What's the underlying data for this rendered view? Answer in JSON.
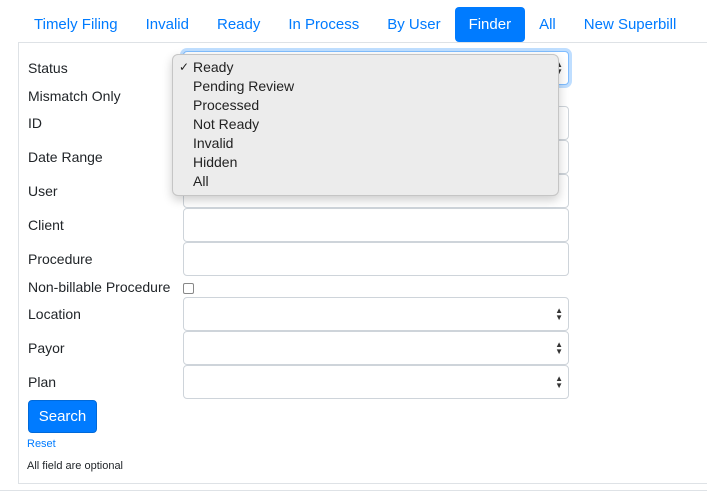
{
  "tabs": [
    {
      "label": "Timely Filing"
    },
    {
      "label": "Invalid"
    },
    {
      "label": "Ready"
    },
    {
      "label": "In Process"
    },
    {
      "label": "By User"
    },
    {
      "label": "Finder",
      "active": true
    },
    {
      "label": "All"
    },
    {
      "label": "New Superbill"
    }
  ],
  "form": {
    "status_label": "Status",
    "mismatch_label": "Mismatch Only",
    "id_label": "ID",
    "date_range_label": "Date Range",
    "user_label": "User",
    "client_label": "Client",
    "procedure_label": "Procedure",
    "nonbillable_label": "Non-billable Procedure",
    "location_label": "Location",
    "payor_label": "Payor",
    "plan_label": "Plan",
    "search_button": "Search",
    "reset_link": "Reset",
    "note": "All field are optional"
  },
  "status_dropdown": {
    "selected": "Ready",
    "options": [
      "Ready",
      "Pending Review",
      "Processed",
      "Not Ready",
      "Invalid",
      "Hidden",
      "All"
    ]
  },
  "colors": {
    "accent": "#007bff"
  }
}
